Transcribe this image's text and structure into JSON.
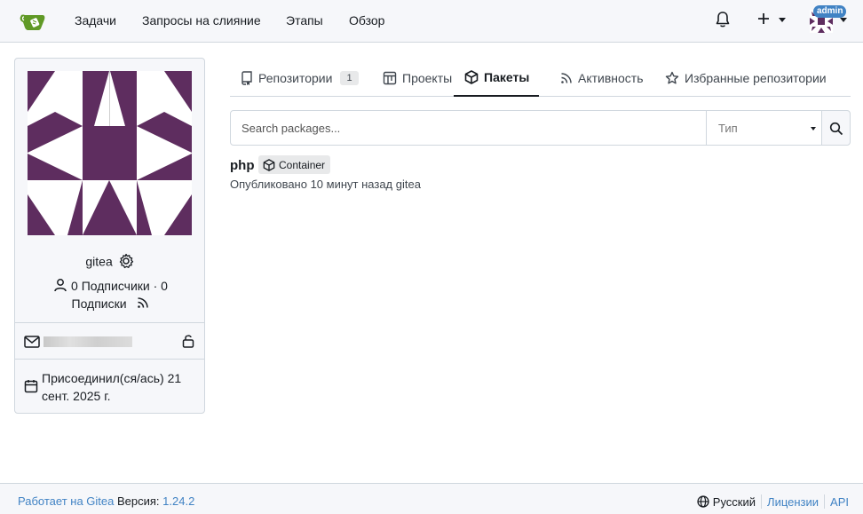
{
  "nav": {
    "items": [
      "Задачи",
      "Запросы на слияние",
      "Этапы",
      "Обзор"
    ],
    "admin_badge": "admin",
    "logo_icon": "gitea-teapot-logo"
  },
  "profile": {
    "username": "gitea",
    "followers": "0 Подписчики · 0",
    "following": "Подписки",
    "joined": "Присоединил(ся/ась) 21 сент. 2025 г.",
    "avatar_color": "#5e2d5f"
  },
  "tabs": [
    {
      "label": "Репозитории",
      "count": "1",
      "icon": "repo-icon"
    },
    {
      "label": "Проекты",
      "icon": "project-icon"
    },
    {
      "label": "Пакеты",
      "icon": "package-icon",
      "active": true
    },
    {
      "label": "Активность",
      "icon": "rss-icon"
    },
    {
      "label": "Избранные репозитории",
      "icon": "star-icon"
    }
  ],
  "search": {
    "placeholder": "Search packages...",
    "type_placeholder": "Тип"
  },
  "packages": [
    {
      "name": "php",
      "type": "Container",
      "meta": "Опубликовано 10 минут назад gitea"
    }
  ],
  "footer": {
    "powered": "Работает на Gitea",
    "version_label": "Версия:",
    "version": "1.24.2",
    "language": "Русский",
    "licenses": "Лицензии",
    "api": "API",
    "accent": "#4183c4"
  }
}
